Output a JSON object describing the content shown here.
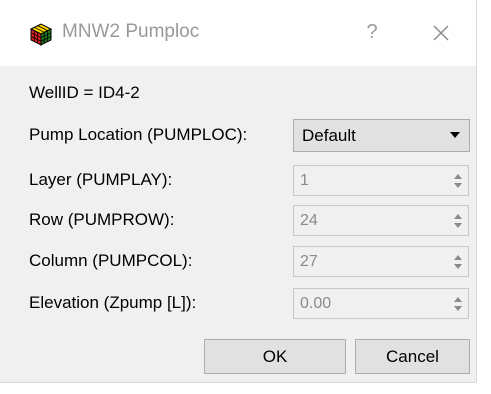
{
  "window": {
    "title": "MNW2 Pumploc",
    "help_glyph": "?",
    "app_icon": "rubiks-cube-icon",
    "close_icon": "close-icon"
  },
  "well": {
    "label": "WellID = ID4-2"
  },
  "pump_location": {
    "label": "Pump Location (PUMPLOC):",
    "selected": "Default"
  },
  "fields": {
    "layer": {
      "label": "Layer (PUMPLAY):",
      "value": "1"
    },
    "row": {
      "label": "Row (PUMPROW):",
      "value": "24"
    },
    "column": {
      "label": "Column (PUMPCOL):",
      "value": "27"
    },
    "elevation": {
      "label": "Elevation (Zpump [L]):",
      "value": "0.00"
    }
  },
  "buttons": {
    "ok": "OK",
    "cancel": "Cancel"
  },
  "colors": {
    "dialog_bg": "#f0f0f0",
    "titlebar_bg": "#ffffff",
    "disabled_text": "#8a8a8a",
    "button_bg": "#e1e1e1"
  }
}
